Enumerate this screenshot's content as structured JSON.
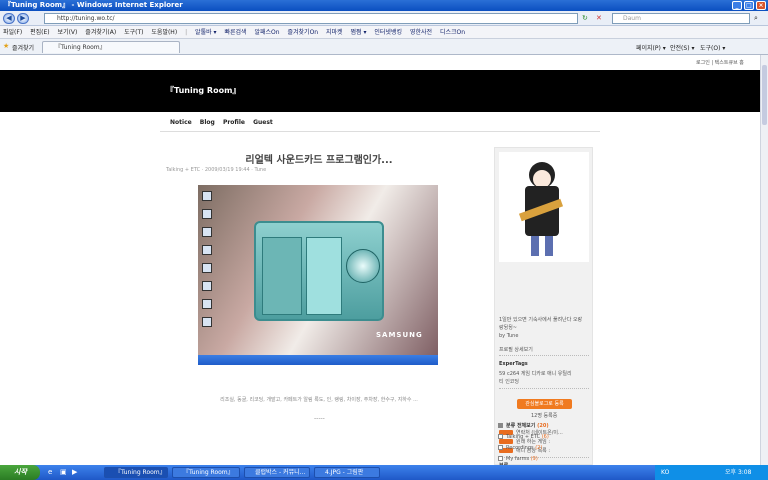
{
  "window": {
    "title": "『Tuning Room』 - Windows Internet Explorer"
  },
  "address": {
    "url": "http://tuning.wo.tc/",
    "search_placeholder": "Daum"
  },
  "menu": {
    "items": [
      "파일(F)",
      "편집(E)",
      "보기(V)",
      "즐겨찾기(A)",
      "도구(T)",
      "도움말(H)"
    ],
    "links": [
      "알툴바 ▾",
      "빠른검색",
      "알패스On",
      "즐겨찾기On",
      "지마켓",
      "쩜쩜 ▾",
      "인터넷뱅킹",
      "영한사전",
      "디스크On"
    ]
  },
  "favbar": {
    "favorites": "즐겨찾기",
    "tab1": "『Tuning Room』",
    "commands": [
      "페이지(P) ▾",
      "안전(S) ▾",
      "도구(O) ▾"
    ]
  },
  "page": {
    "top_links": "로그인 | 텍스트큐브 홈",
    "blog_title": "『Tuning Room』",
    "nav": [
      "Notice",
      "Blog",
      "Profile",
      "Guest"
    ],
    "post_title": "리얼텍 사운드카드 프로그램인가...",
    "post_meta": "Talking + ETC · 2009/03/19 19:44 · Tune",
    "image_brand": "SAMSUNG",
    "tags": "리조실, 동굴, 리코딩, 개발고, 카페트가 알림 록도, 인, 랭링, 차이장, 주차장, 한수구, 지하수 ...",
    "divider": "-----"
  },
  "sidebar": {
    "profile_line1": "1일만 있으면 기숙사에서 풀려난다 오랑",
    "profile_line2": "랑뒹뒹~",
    "profile_name": "by Tune",
    "profile_link": "프로필 상세보기",
    "tags_title": "ExperTags",
    "tags_line1": "59  c264  게임  디카로  애니  유틸리",
    "tags_line2": "티  인코딩",
    "subscribe": "관심블로그로 등록",
    "subscribers": "12명 등록중",
    "rss_items": [
      "연락처 (네이트온/이...",
      "원래 하는 게임 :",
      "애니 감상 목록 :"
    ],
    "category_title": "분류",
    "category_all": "분류 전체보기",
    "category_all_count": "(20)",
    "categories": [
      {
        "name": "Talking + ETC",
        "count": "(6)"
      },
      {
        "name": "Recordings",
        "count": "(2)"
      },
      {
        "name": "My farms",
        "count": "(9)"
      }
    ]
  },
  "taskbar": {
    "start": "시작",
    "tasks": [
      "『Tuning Room』",
      "『Tuning Room』",
      "클럽박스 - 커뮤니...",
      "4.JPG - 그림판"
    ],
    "lang": "KO",
    "clock": "오후 3:08"
  }
}
